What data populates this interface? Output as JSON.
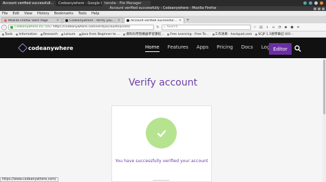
{
  "taskbar": {
    "tasks": [
      "Account verified successfull...",
      "Codeanywhere - Google C...",
      "tensile - File Manager"
    ]
  },
  "window": {
    "title": "Account verified successfully - Codeanywhere - Mozilla Firefox"
  },
  "menu": [
    "File",
    "Edit",
    "View",
    "History",
    "Bookmarks",
    "Tools",
    "Help"
  ],
  "tabs": [
    {
      "label": "Mozilla Firefox Start Page",
      "active": false
    },
    {
      "label": "Codeanywhere - Verify your ac...",
      "active": false
    },
    {
      "label": "Account verified successfull...",
      "active": true
    }
  ],
  "navbar": {
    "site_identity": "Codeanywhere Inc (US)",
    "url": "https://codeanywhere.com/verifyaccountsuccess",
    "search_placeholder": "Search"
  },
  "bookmarks": [
    "Tools",
    "Information",
    "Research",
    "Leisure",
    "Java from Beginner to ...",
    "資料科學暨機器學習課程...",
    "Free Learning - Free Te...",
    "工作清單 - hackpad.com",
    "SCJP 1.5教學筆記 001 -"
  ],
  "site": {
    "logo_text": "codeanywhere",
    "nav": [
      "Home",
      "Features",
      "Apps",
      "Pricing",
      "Docs",
      "Logout"
    ],
    "active_nav": "Home",
    "editor_label": "Editor",
    "heading": "Verify account",
    "message": "You have successfully verified your account"
  },
  "status": {
    "text": "https://www.codeanywhere.com/"
  },
  "colors": {
    "brand_purple": "#6c2ea3",
    "heading_purple": "#6a3fa6",
    "check_green": "#b5e38f",
    "nav_bg": "#111111"
  }
}
